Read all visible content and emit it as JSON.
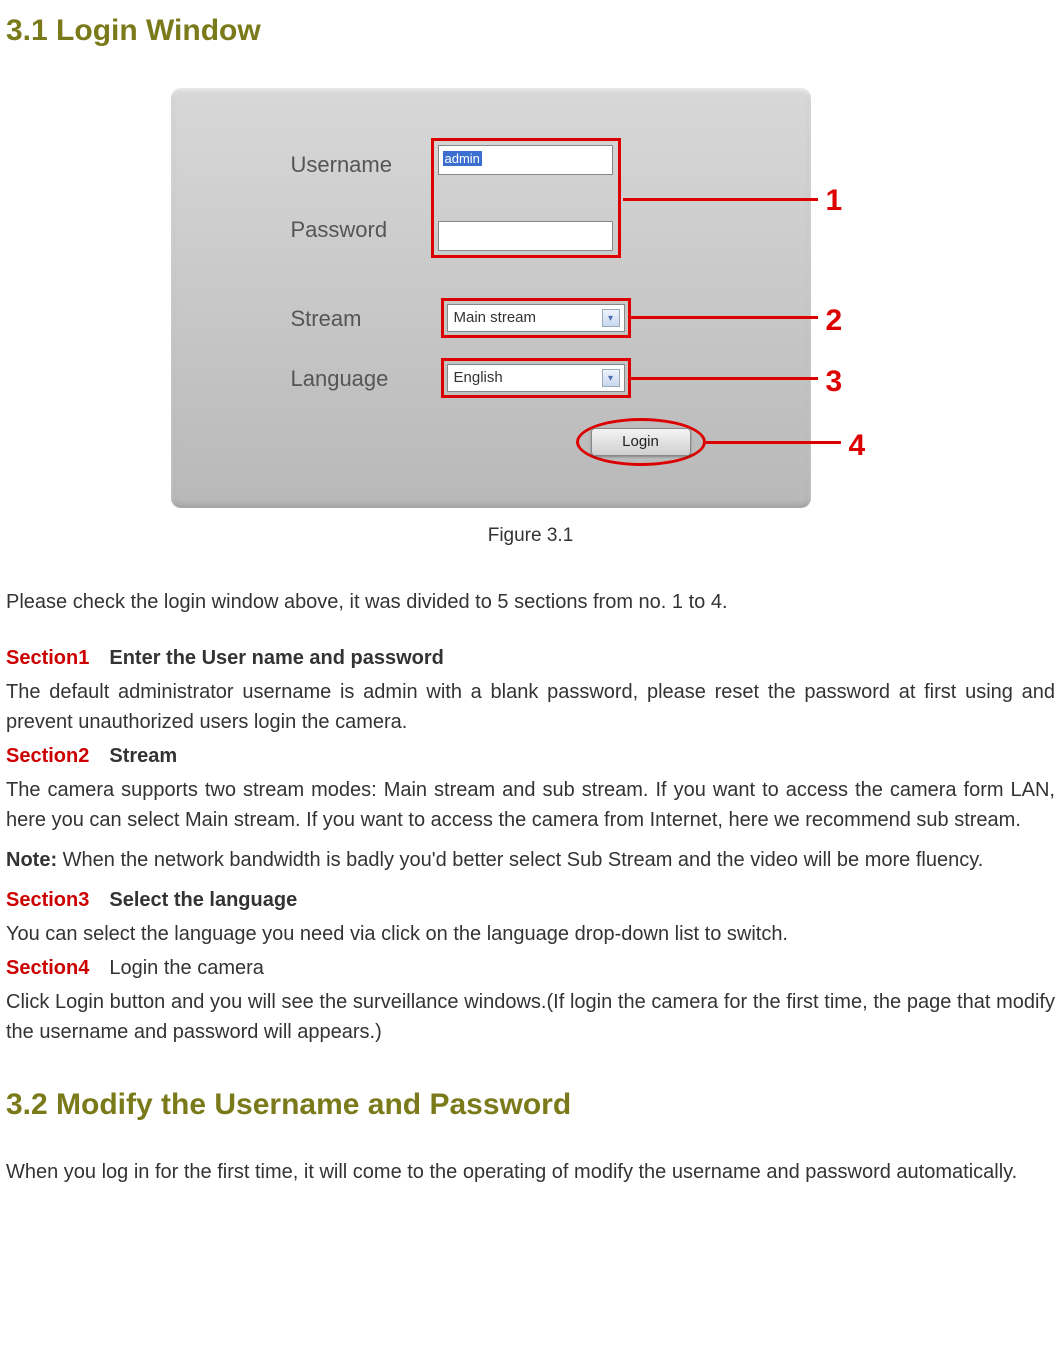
{
  "headings": {
    "h31": "3.1    Login Window",
    "h32": "3.2    Modify the Username and Password"
  },
  "figure": {
    "caption": "Figure 3.1",
    "labels": {
      "username": "Username",
      "password": "Password",
      "stream": "Stream",
      "language": "Language"
    },
    "values": {
      "username": "admin",
      "password": "",
      "stream": "Main stream",
      "language": "English"
    },
    "login_button": "Login",
    "callouts": {
      "c1": "1",
      "c2": "2",
      "c3": "3",
      "c4": "4"
    }
  },
  "body": {
    "intro": "Please check the login window above, it was divided to 5 sections from no. 1 to 4.",
    "s1_label": "Section1",
    "s1_title": "Enter the User name and password",
    "s1_text": "The default administrator username is admin with a blank password, please reset the password at first using and prevent unauthorized users login the camera.",
    "s2_label": "Section2",
    "s2_title": "Stream",
    "s2_text": "The camera supports two stream modes: Main stream and sub stream. If you want to access the camera form LAN, here you can select Main stream. If you want to access the camera from Internet, here we recommend sub stream.",
    "note_label": "Note:",
    "note_text": " When the network bandwidth is badly you'd better select Sub Stream and the video will be more fluency.",
    "s3_label": "Section3",
    "s3_title": "Select the language",
    "s3_text": "You can select the language you need via click on the language drop-down list to switch.",
    "s4_label": "Section4",
    "s4_title": "Login the camera",
    "s4_text": "Click Login button and you will see the surveillance windows.(If login the camera for the first time, the page that modify the username and password will appears.)",
    "p32": "When you log in for the first time, it will come to the operating of modify the username and password automatically."
  }
}
